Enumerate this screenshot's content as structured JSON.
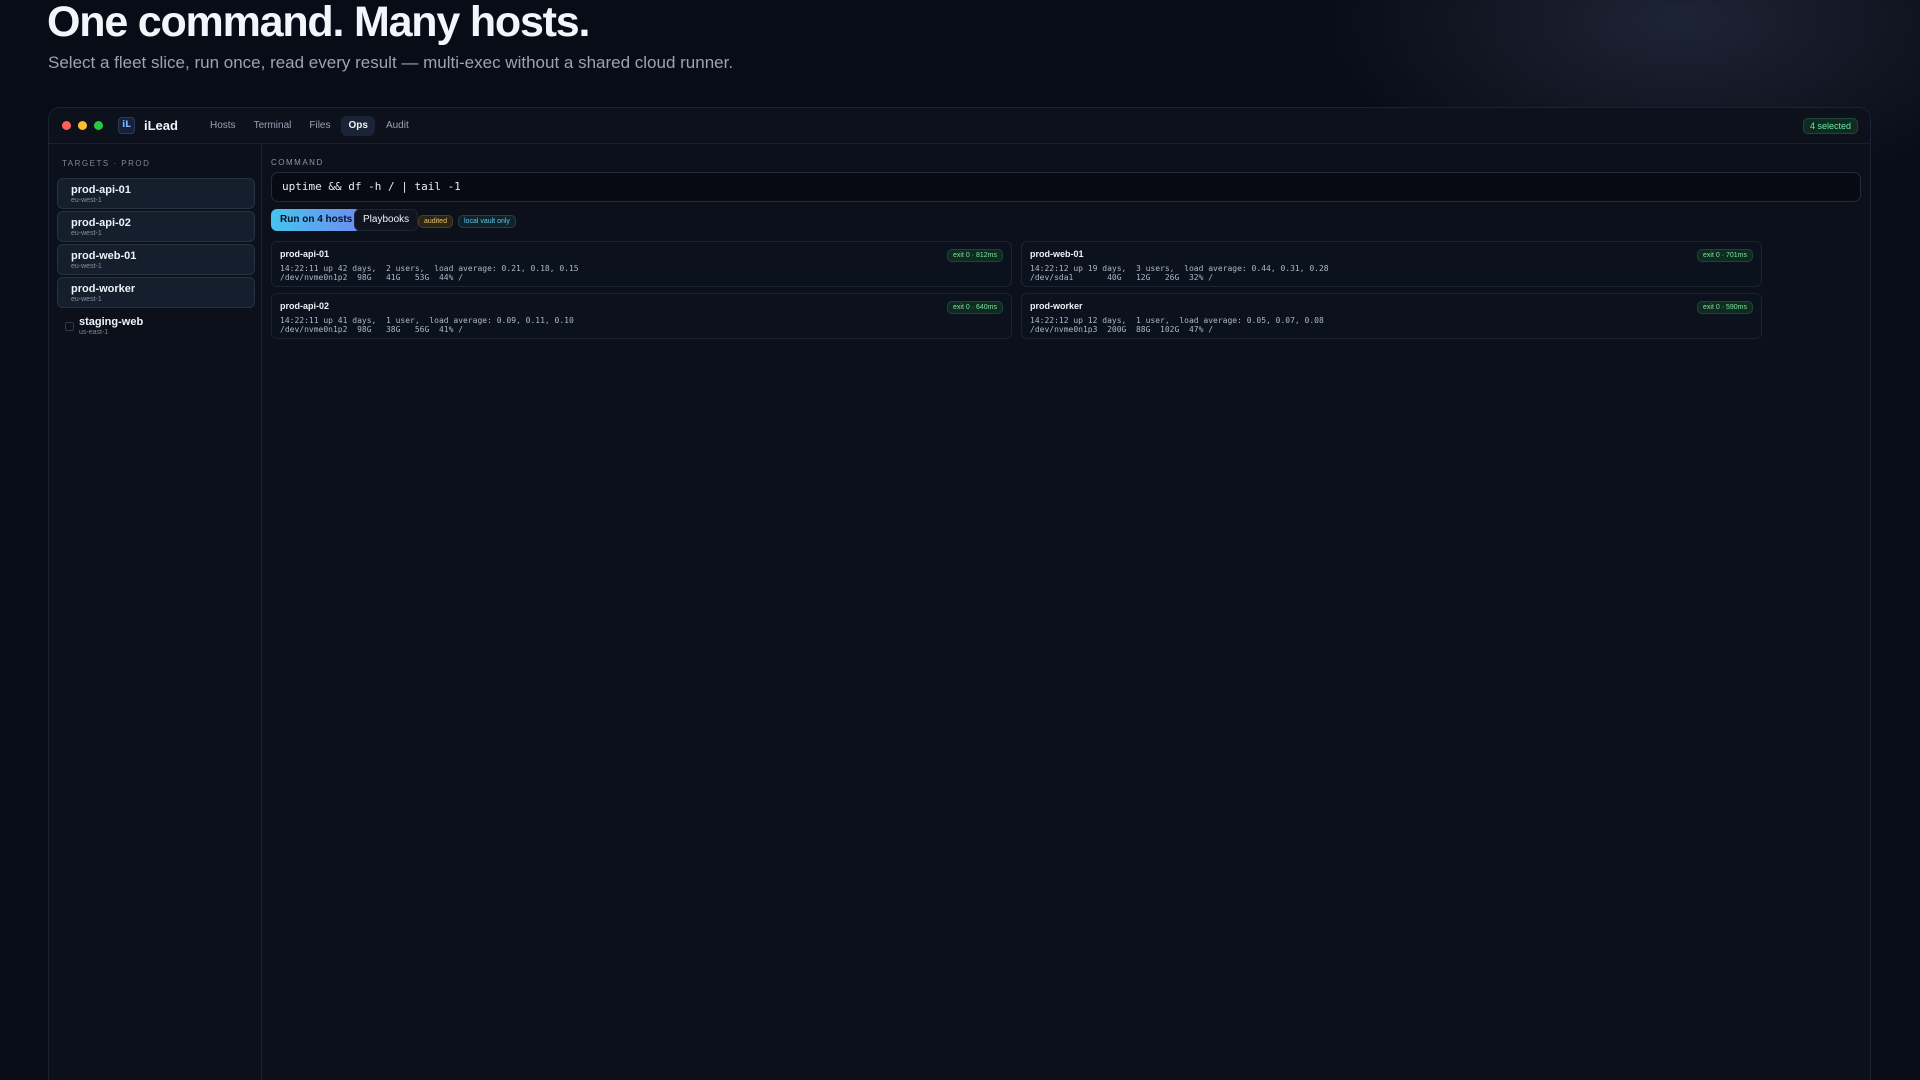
{
  "hero": {
    "title": "One command. Many hosts.",
    "subtitle": "Select a fleet slice, run once, read every result — multi-exec without a shared cloud runner."
  },
  "app": {
    "logo": "iL",
    "name": "iLead",
    "nav": [
      "Hosts",
      "Terminal",
      "Files",
      "Ops",
      "Audit"
    ],
    "active_nav": "Ops",
    "selected_badge": "4 selected"
  },
  "sidebar": {
    "title": "TARGETS · PROD",
    "hosts": [
      {
        "name": "prod-api-01",
        "region": "eu-west-1",
        "selected": true
      },
      {
        "name": "prod-api-02",
        "region": "eu-west-1",
        "selected": true
      },
      {
        "name": "prod-web-01",
        "region": "eu-west-1",
        "selected": true
      },
      {
        "name": "prod-worker",
        "region": "eu-west-1",
        "selected": true
      },
      {
        "name": "staging-web",
        "region": "us-east-1",
        "selected": false
      }
    ]
  },
  "command": {
    "label": "COMMAND",
    "value": "uptime && df -h / | tail -1",
    "run_label": "Run on 4 hosts",
    "playbooks_label": "Playbooks",
    "tags": [
      "audited",
      "local vault only"
    ]
  },
  "results": [
    {
      "host": "prod-api-01",
      "exit": "exit 0 · 812ms",
      "line1": "14:22:11 up 42 days,  2 users,  load average: 0.21, 0.18, 0.15",
      "line2": "/dev/nvme0n1p2  98G   41G   53G  44% /"
    },
    {
      "host": "prod-web-01",
      "exit": "exit 0 · 701ms",
      "line1": "14:22:12 up 19 days,  3 users,  load average: 0.44, 0.31, 0.28",
      "line2": "/dev/sda1       40G   12G   26G  32% /"
    },
    {
      "host": "prod-api-02",
      "exit": "exit 0 · 640ms",
      "line1": "14:22:11 up 41 days,  1 user,  load average: 0.09, 0.11, 0.10",
      "line2": "/dev/nvme0n1p2  98G   38G   56G  41% /"
    },
    {
      "host": "prod-worker",
      "exit": "exit 0 · 590ms",
      "line1": "14:22:12 up 12 days,  1 user,  load average: 0.05, 0.07, 0.08",
      "line2": "/dev/nvme0n1p3  200G  88G  102G  47% /"
    }
  ],
  "colors": {
    "accent_start": "#45c4ee",
    "accent_end": "#6f8df2",
    "success": "#7fe3a6",
    "background": "#080c16"
  }
}
